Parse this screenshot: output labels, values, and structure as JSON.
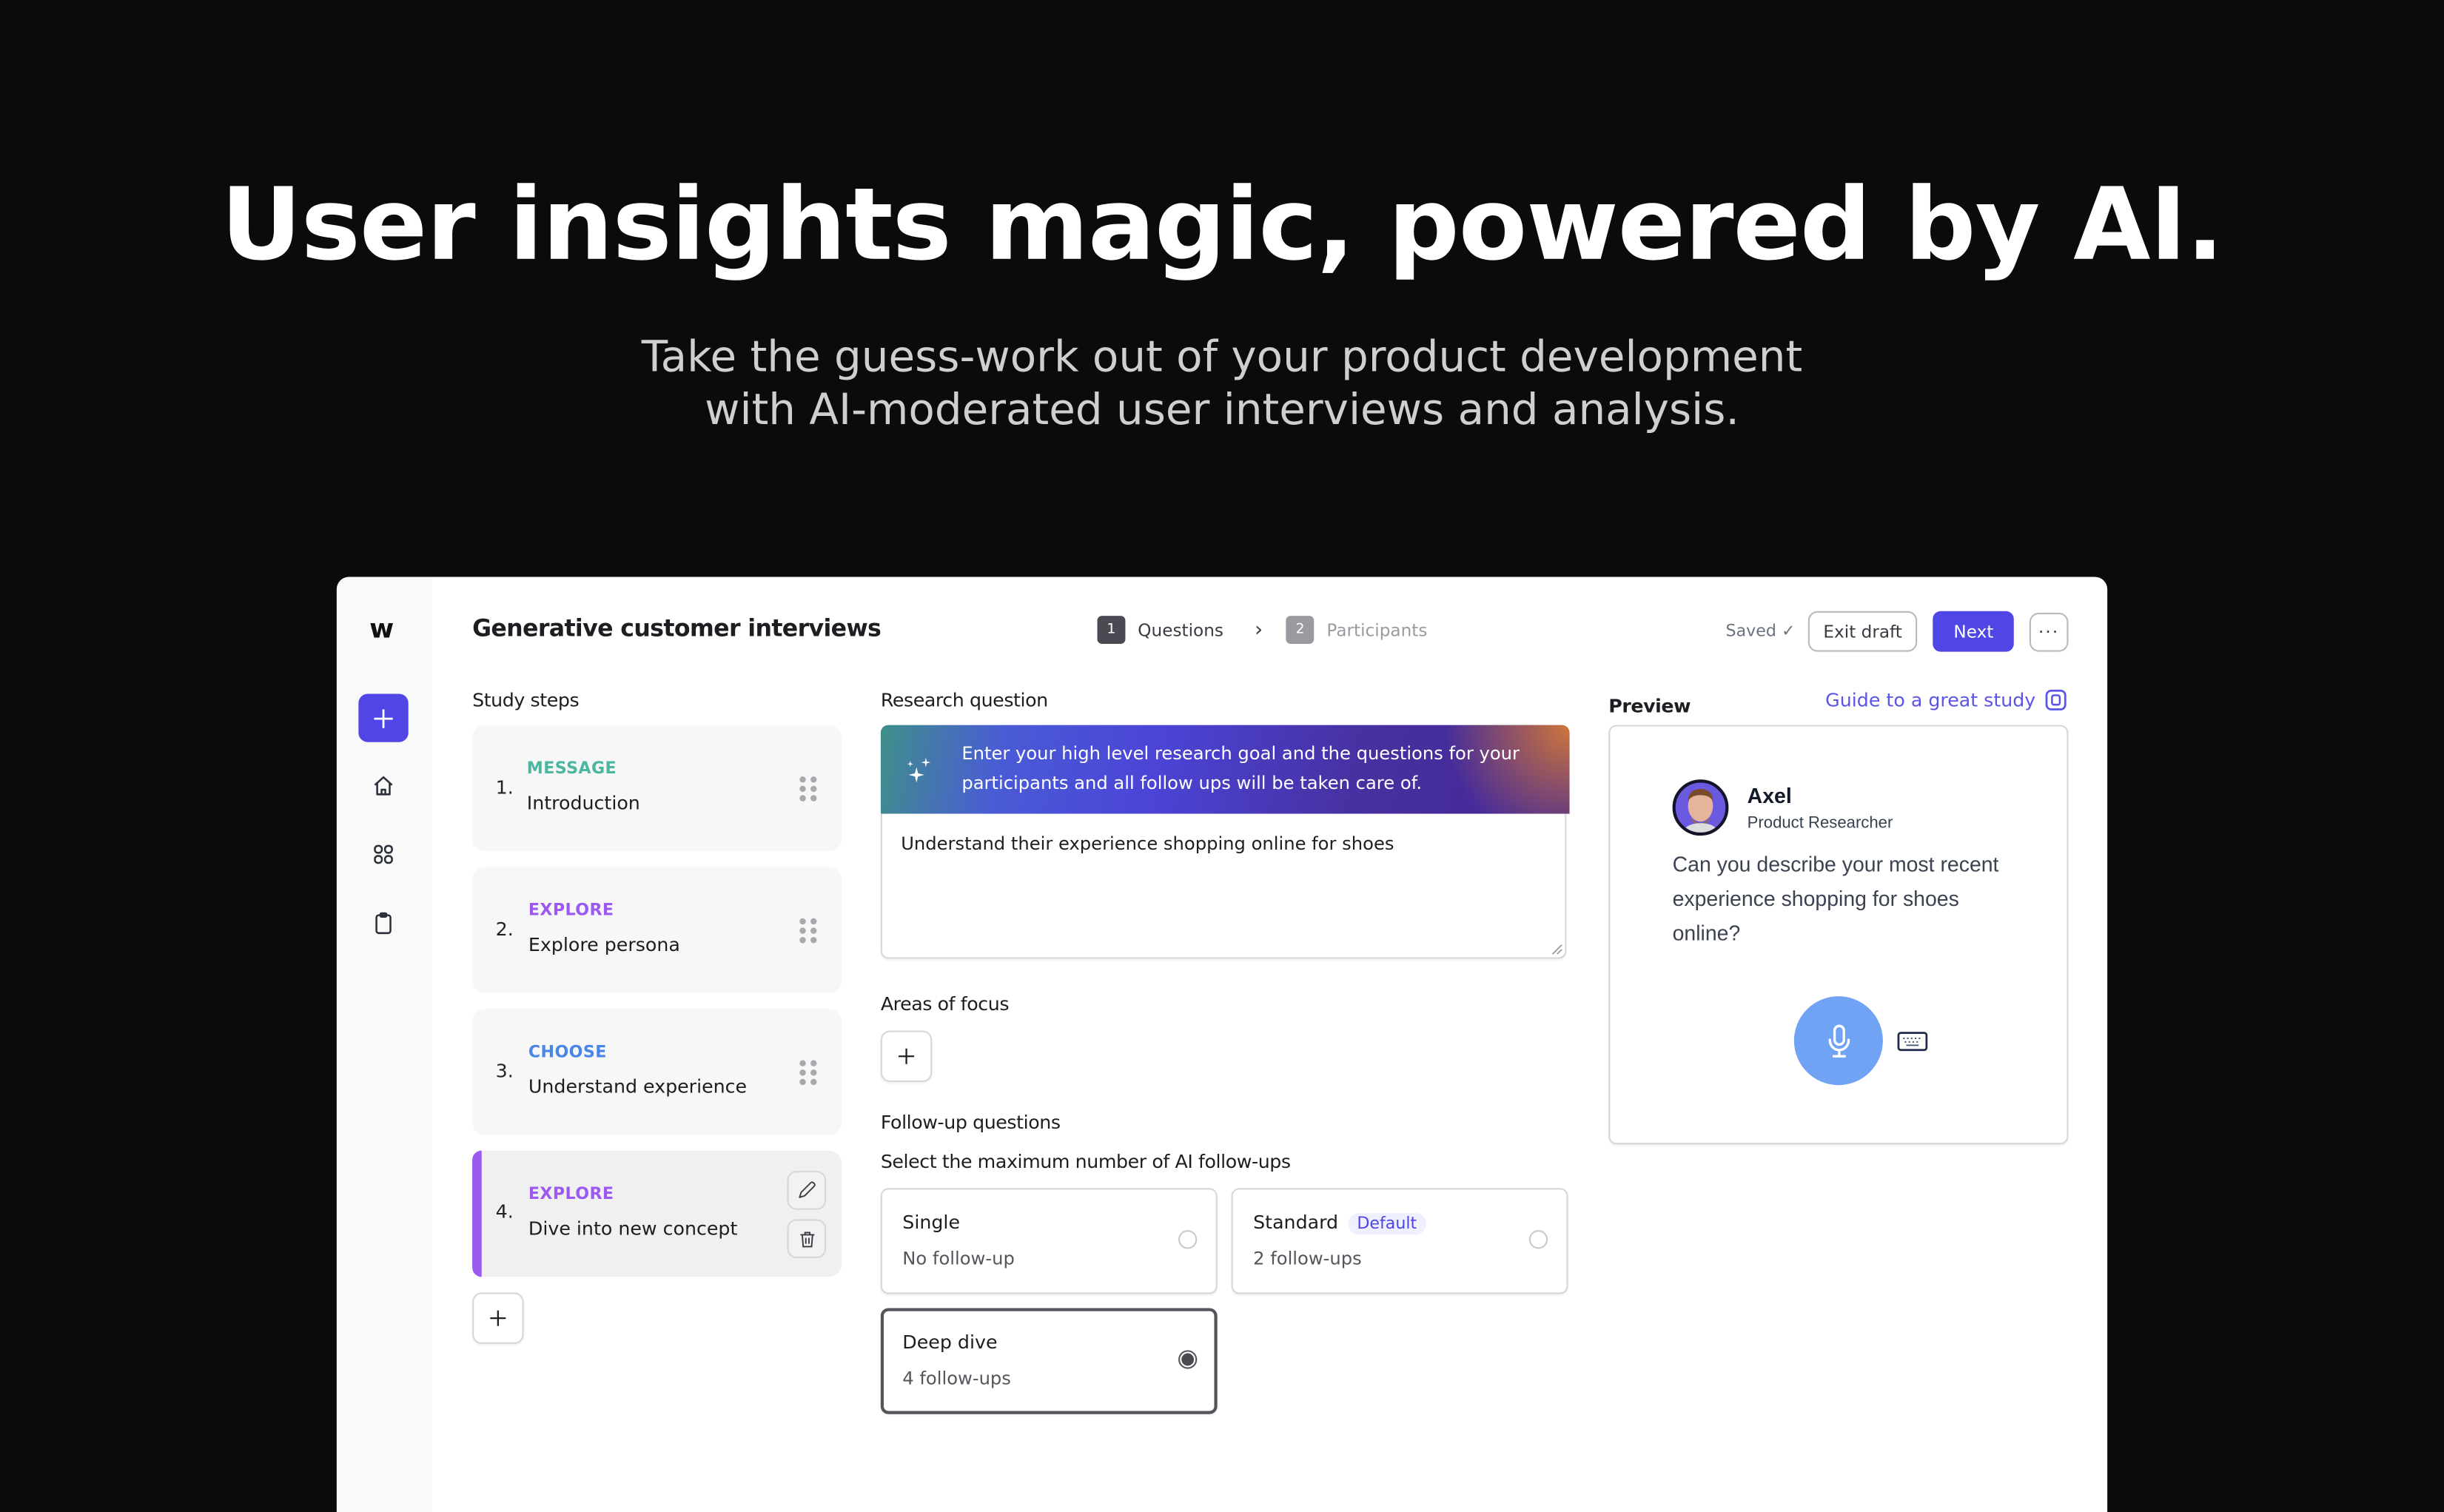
{
  "hero": {
    "title": "User insights magic, powered by AI.",
    "subtitle_line1": "Take the guess-work out of your product development",
    "subtitle_line2": "with AI-moderated user interviews and analysis."
  },
  "app": {
    "logo": "w",
    "rail": [
      {
        "icon": "plus-icon",
        "label": "New"
      },
      {
        "icon": "home-icon",
        "label": "Home"
      },
      {
        "icon": "grid-icon",
        "label": "Apps"
      },
      {
        "icon": "clipboard-icon",
        "label": "Studies"
      }
    ],
    "title": "Generative customer interviews",
    "stepper": [
      {
        "num": "1",
        "label": "Questions",
        "active": true
      },
      {
        "num": "2",
        "label": "Participants",
        "active": false
      }
    ],
    "saved_label": "Saved",
    "exit_label": "Exit draft",
    "next_label": "Next",
    "more_label": "···",
    "colors": {
      "accent": "#4f46e5",
      "message": "#4db6a0",
      "explore": "#9b59f0",
      "choose": "#4a86e8"
    }
  },
  "study_steps": {
    "label": "Study steps",
    "items": [
      {
        "index": "1.",
        "type": "MESSAGE",
        "name": "Introduction",
        "color": "#4db6a0"
      },
      {
        "index": "2.",
        "type": "EXPLORE",
        "name": "Explore persona",
        "color": "#9b59f0"
      },
      {
        "index": "3.",
        "type": "CHOOSE",
        "name": "Understand experience",
        "color": "#4a86e8"
      },
      {
        "index": "4.",
        "type": "EXPLORE",
        "name": "Dive into new concept",
        "color": "#9b59f0",
        "selected": true
      }
    ]
  },
  "research": {
    "label": "Research question",
    "banner": "Enter your high level research goal and the questions for your participants and all follow ups will be taken care of.",
    "value": "Understand their experience shopping online for shoes"
  },
  "focus": {
    "label": "Areas of focus"
  },
  "followups": {
    "label": "Follow-up questions",
    "sublabel": "Select the maximum number of AI follow-ups",
    "options": [
      {
        "title": "Single",
        "sub": "No follow-up",
        "selected": false
      },
      {
        "title": "Standard",
        "badge": "Default",
        "sub": "2 follow-ups",
        "selected": false
      },
      {
        "title": "Deep dive",
        "sub": "4 follow-ups",
        "selected": true
      }
    ]
  },
  "preview": {
    "label": "Preview",
    "guide_link": "Guide to a great study",
    "name": "Axel",
    "role": "Product Researcher",
    "question": "Can you describe your most recent experience shopping for shoes online?"
  }
}
